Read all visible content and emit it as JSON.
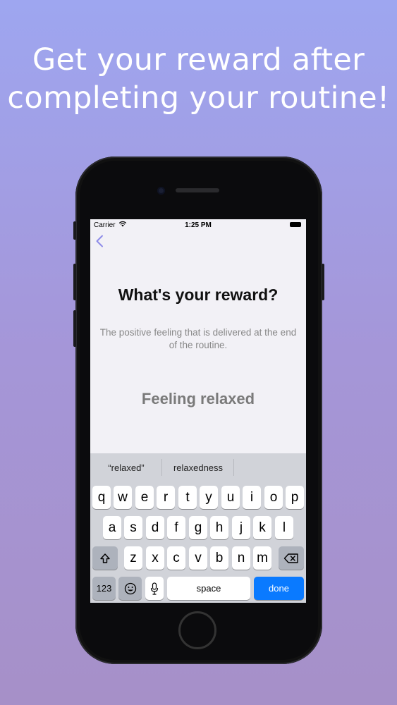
{
  "headline": {
    "line1": "Get your reward after",
    "line2": "completing your routine!"
  },
  "status_bar": {
    "carrier": "Carrier",
    "time": "1:25 PM",
    "icons": [
      "wifi-icon",
      "battery-icon"
    ]
  },
  "nav": {
    "back_icon": "chevron-left-icon"
  },
  "screen": {
    "title": "What's your reward?",
    "subtitle": "The positive feeling that is delivered at the end of the routine.",
    "reward_value": "Feeling relaxed"
  },
  "keyboard": {
    "suggestions": [
      "“relaxed”",
      "relaxedness",
      ""
    ],
    "row1": [
      "q",
      "w",
      "e",
      "r",
      "t",
      "y",
      "u",
      "i",
      "o",
      "p"
    ],
    "row2": [
      "a",
      "s",
      "d",
      "f",
      "g",
      "h",
      "j",
      "k",
      "l"
    ],
    "row3": [
      "z",
      "x",
      "c",
      "v",
      "b",
      "n",
      "m"
    ],
    "shift_icon": "shift-icon",
    "delete_icon": "delete-icon",
    "numbers_label": "123",
    "emoji_icon": "emoji-icon",
    "mic_icon": "microphone-icon",
    "space_label": "space",
    "done_label": "done"
  },
  "colors": {
    "accent": "#8e8ce8",
    "done_button": "#0a7aff",
    "background_top": "#9ea6f0",
    "background_bottom": "#a690c8"
  }
}
